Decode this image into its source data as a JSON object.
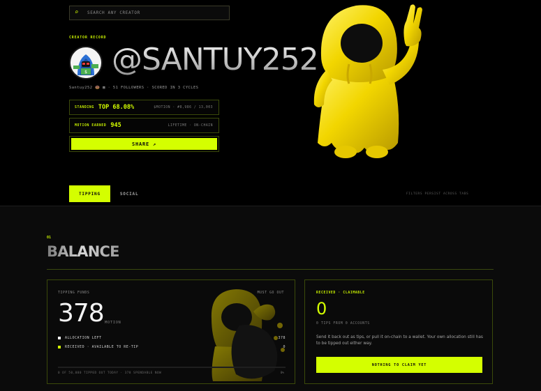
{
  "search": {
    "placeholder": "SEARCH ANY CREATOR",
    "icon": "search-icon"
  },
  "profile": {
    "record_label": "CREATOR RECORD",
    "handle": "@SANTUY252",
    "meta": "Santuy252 🍩 ▦ · 51 FOLLOWERS · SCORED IN 3 CYCLES"
  },
  "stats": [
    {
      "label": "STANDING",
      "value": "TOP 68.08%",
      "right": "$MOTION · #8,986 / 13,003"
    },
    {
      "label": "MOTION EARNED",
      "value": "945",
      "right": "LIFETIME · ON-CHAIN"
    }
  ],
  "share": {
    "label": "SHARE ↗"
  },
  "tabs": [
    {
      "label": "TIPPING",
      "active": true
    },
    {
      "label": "SOCIAL",
      "active": false
    }
  ],
  "filters_note": "FILTERS PERSIST ACROSS TABS",
  "balance": {
    "section_number": "01",
    "title": "BALANCE",
    "tipping_funds": {
      "title": "TIPPING FUNDS",
      "must_go_out": "MUST GO OUT",
      "amount": "378",
      "unit": "MOTION",
      "legend": [
        {
          "label": "ALLOCATION LEFT",
          "value": "378",
          "color": "#f4f4f4"
        },
        {
          "label": "RECEIVED · AVAILABLE TO RE-TIP",
          "value": "0",
          "color": "#d4ff00"
        }
      ],
      "progress_fraction": 0.0,
      "footer": "0 OF 50,000 TIPPED OUT TODAY · 378 SPENDABLE NOW",
      "footer_right": "0%"
    },
    "received": {
      "title": "RECEIVED · CLAIMABLE",
      "amount": "0",
      "sub": "0 TIPS FROM 0 ACCOUNTS",
      "description": "Send it back out as tips, or pull it on-chain to a wallet. Your own allocation still has to be tipped out either way.",
      "button": "NOTHING TO CLAIM YET"
    }
  },
  "colors": {
    "accent": "#d4ff00",
    "background": "#000000",
    "panel": "#0b0b0b",
    "border": "#3b4a0a"
  }
}
